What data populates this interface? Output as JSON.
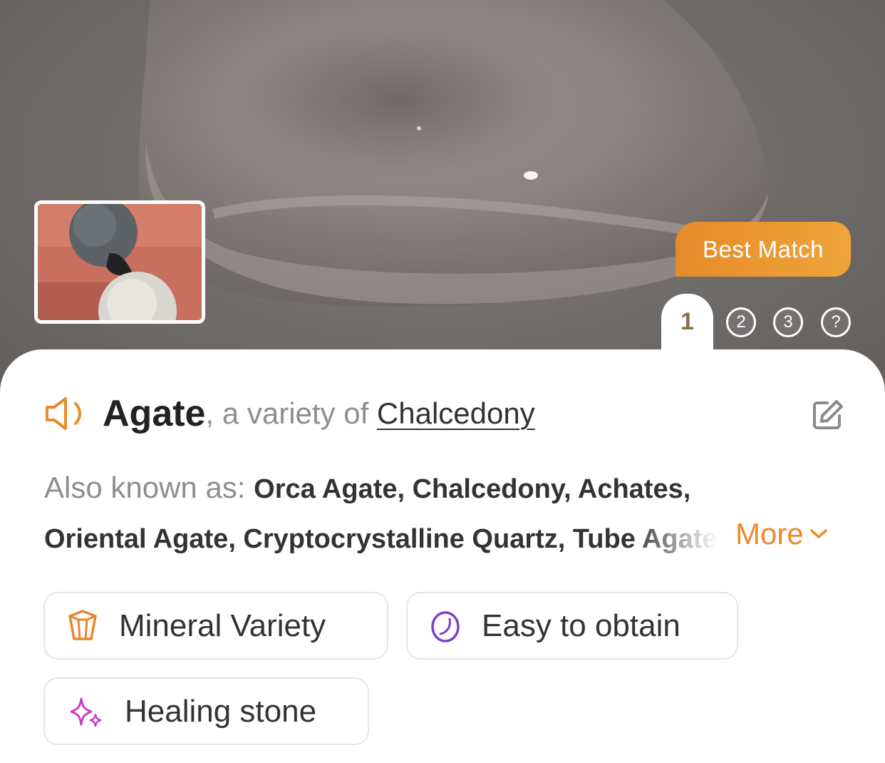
{
  "hero": {
    "badge_label": "Best Match",
    "pages": [
      "1",
      "2",
      "3",
      "?"
    ],
    "active_page": "1"
  },
  "title": {
    "name": "Agate",
    "connector": ", a variety of ",
    "parent": "Chalcedony"
  },
  "aka": {
    "label": "Also known as: ",
    "line1": "Orca Agate, Chalcedony, Achates,",
    "line2": "Oriental Agate, Cryptocrystalline Quartz, ",
    "line2_fade": "Tube Agate",
    "more_label": "More"
  },
  "chips": [
    {
      "label": "Mineral Variety",
      "icon": "crystal-icon",
      "color": "#e8862c"
    },
    {
      "label": "Easy to obtain",
      "icon": "gem-outline-icon",
      "color": "#7b3fd6"
    },
    {
      "label": "Healing stone",
      "icon": "sparkle-icon",
      "color": "#c23fc7"
    }
  ],
  "colors": {
    "accent": "#ea8a2c",
    "badge_gradient_start": "#e58a2a",
    "badge_gradient_end": "#f0a43a"
  }
}
